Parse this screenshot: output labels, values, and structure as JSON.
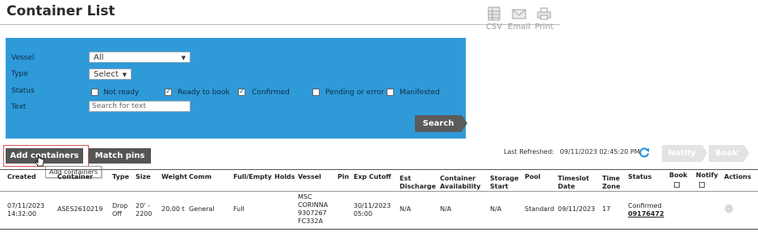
{
  "page": {
    "title": "Container List"
  },
  "toolbar": {
    "csv": "CSV",
    "email": "Email",
    "print": "Print"
  },
  "filters": {
    "vessel_label": "Vessel",
    "vessel_value": "All",
    "type_label": "Type",
    "type_value": "Select",
    "status_label": "Status",
    "status_options": [
      {
        "label": "Not ready",
        "checked": false
      },
      {
        "label": "Ready to book",
        "checked": true
      },
      {
        "label": "Confirmed",
        "checked": true
      },
      {
        "label": "Pending or error",
        "checked": false
      },
      {
        "label": "Manifested",
        "checked": false
      }
    ],
    "text_label": "Text",
    "text_placeholder": "Search for text",
    "search_button": "Search"
  },
  "actions": {
    "add_containers": "Add containers",
    "match_pins": "Match pins",
    "tooltip": "Add containers",
    "last_refreshed_label": "Last Refreshed:",
    "last_refreshed_value": "09/11/2023 02:45:20 PM",
    "notify": "Notify",
    "book": "Book"
  },
  "table": {
    "columns": [
      "Created",
      "Container",
      "Type",
      "Size",
      "Weight",
      "Comm",
      "Full/Empty",
      "Holds",
      "Vessel",
      "Pin",
      "Exp Cutoff",
      "Est\nDischarge",
      "Container\nAvailability",
      "Storage\nStart",
      "Pool",
      "Timeslot\nDate",
      "Time\nZone",
      "Status",
      "Book",
      "Notify",
      "Actions"
    ],
    "rows": [
      {
        "created": "07/11/2023\n14:32:00",
        "container": "ASES2610219",
        "type": "Drop\nOff",
        "size": "20' -\n2200",
        "weight": "20.00 t",
        "comm": "General",
        "full_empty": "Full",
        "holds": "",
        "vessel": "MSC\nCORINNA\n9307267\nFC332A",
        "pin": "",
        "exp_cutoff": "30/11/2023\n05:00",
        "est_discharge": "N/A",
        "container_availability": "N/A",
        "storage_start": "N/A",
        "pool": "Standard",
        "timeslot_date": "09/11/2023",
        "time_zone": "17",
        "status": "Confirmed",
        "status_ref": "09176472"
      }
    ]
  },
  "colors": {
    "panel": "#2f9ad8",
    "dark_button": "#555555",
    "refresh": "#1a8fd8"
  }
}
